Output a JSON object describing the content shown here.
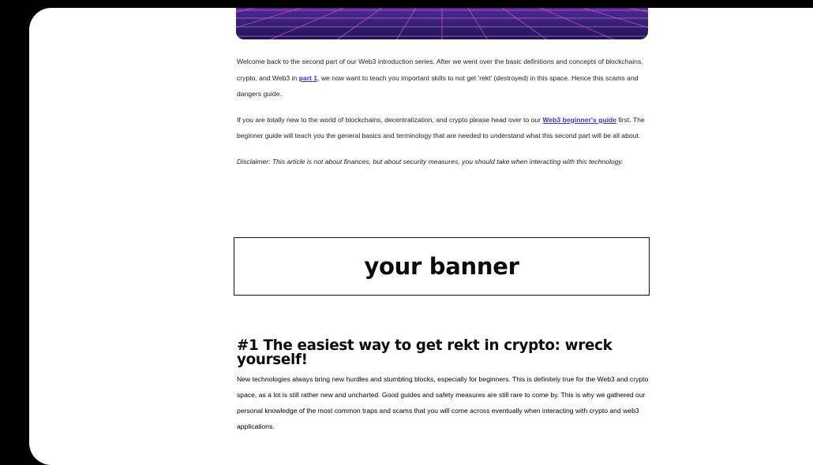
{
  "article": {
    "intro": {
      "before_link": "Welcome back to the second part of our Web3 introduction series. After we went over the basic definitions and concepts of blockchains, crypto, and Web3 in ",
      "link": "part 1",
      "after_link": ", we now want to teach you important skills to not get 'rekt' (destroyed) in this space. Hence this scams and dangers guide."
    },
    "beginner": {
      "before_link": "If you are totally new to the world of blockchains, decentralization, and crypto please head over to our ",
      "link": "Web3 beginner's guide",
      "after_link": " first. The beginner guide will teach you the general basics and terminology that are needed to understand what this second part will be all about."
    },
    "disclaimer": "Disclaimer: This article is not about finances, but about security measures, you should take when interacting with this technology."
  },
  "banner": {
    "label": "your banner"
  },
  "section1": {
    "heading": "#1 The easiest way to get rekt in crypto: wreck yourself!",
    "body": "New technologies always bring new hurdles and stumbling blocks, especially for beginners. This is definitely true for the Web3 and crypto space, as a lot is still rather new and uncharted. Good guides and safety measures are still rare to come by. This is why we gathered our personal knowledge of the most common traps and scams that you will come across eventually when interacting with crypto and web3 applications."
  },
  "colors": {
    "background": "#000000",
    "page": "#ffffff",
    "link": "#3a35c8",
    "hero_top": "#6a2aa0",
    "hero_bottom": "#1e1550"
  }
}
